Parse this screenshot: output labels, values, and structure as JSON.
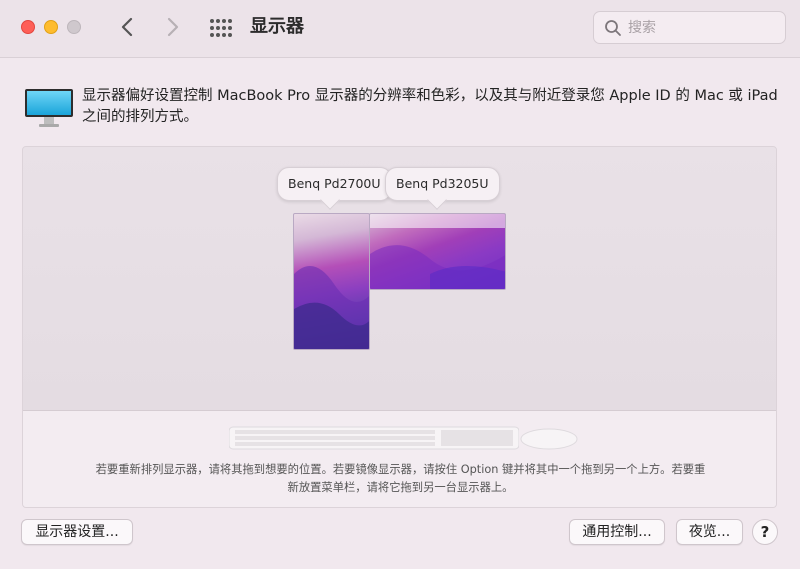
{
  "window": {
    "title": "显示器",
    "search_placeholder": "搜索"
  },
  "description": "显示器偏好设置控制 MacBook Pro 显示器的分辨率和色彩，以及其与附近登录您 Apple ID 的 Mac 或 iPad 之间的排列方式。",
  "arrangement": {
    "displays": [
      {
        "label": "Benq Pd2700U",
        "orientation": "portrait"
      },
      {
        "label": "Benq Pd3205U",
        "orientation": "landscape"
      }
    ],
    "hint": "若要重新排列显示器，请将其拖到想要的位置。若要镜像显示器，请按住 Option 键并将其中一个拖到另一个上方。若要重新放置菜单栏，请将它拖到另一台显示器上。"
  },
  "buttons": {
    "display_settings": "显示器设置...",
    "universal_control": "通用控制...",
    "night_shift": "夜览...",
    "help": "?"
  },
  "colors": {
    "close": "#fe5f57",
    "minimize": "#febc2e",
    "zoom": "#cfc8cd"
  }
}
